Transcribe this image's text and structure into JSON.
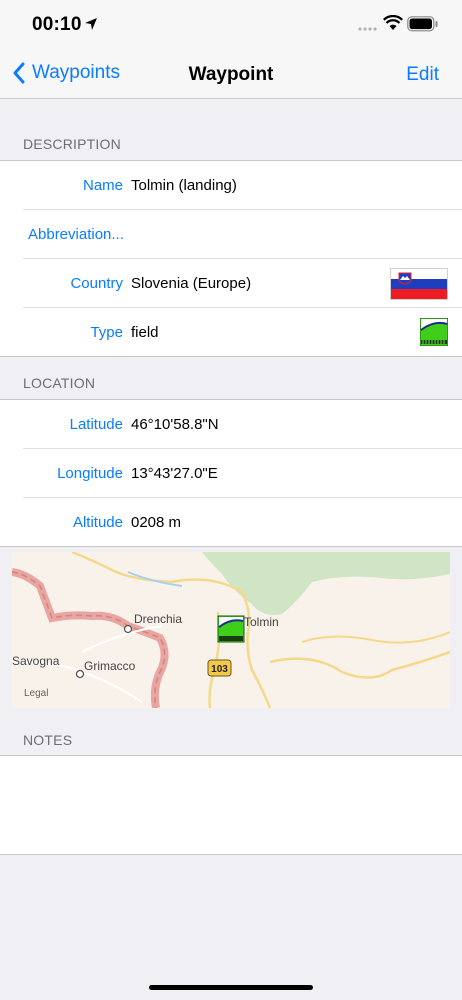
{
  "status": {
    "time": "00:10"
  },
  "nav": {
    "back_label": "Waypoints",
    "title": "Waypoint",
    "edit_label": "Edit"
  },
  "description": {
    "header": "DESCRIPTION",
    "name_label": "Name",
    "name_value": "Tolmin (landing)",
    "abbreviation_label": "Abbreviation...",
    "country_label": "Country",
    "country_value": "Slovenia (Europe)",
    "type_label": "Type",
    "type_value": "field"
  },
  "location": {
    "header": "LOCATION",
    "latitude_label": "Latitude",
    "latitude_value": "46°10'58.8\"N",
    "longitude_label": "Longitude",
    "longitude_value": "13°43'27.0\"E",
    "altitude_label": "Altitude",
    "altitude_value": "0208 m"
  },
  "map": {
    "labels": {
      "drenchia": "Drenchia",
      "tolmin": "Tolmin",
      "savogna": "Savogna",
      "grimacco": "Grimacco",
      "road": "103",
      "legal": "Legal"
    }
  },
  "notes": {
    "header": "NOTES"
  },
  "colors": {
    "accent": "#0a7cff",
    "separator": "#c8c7cc",
    "background": "#efeff4"
  }
}
